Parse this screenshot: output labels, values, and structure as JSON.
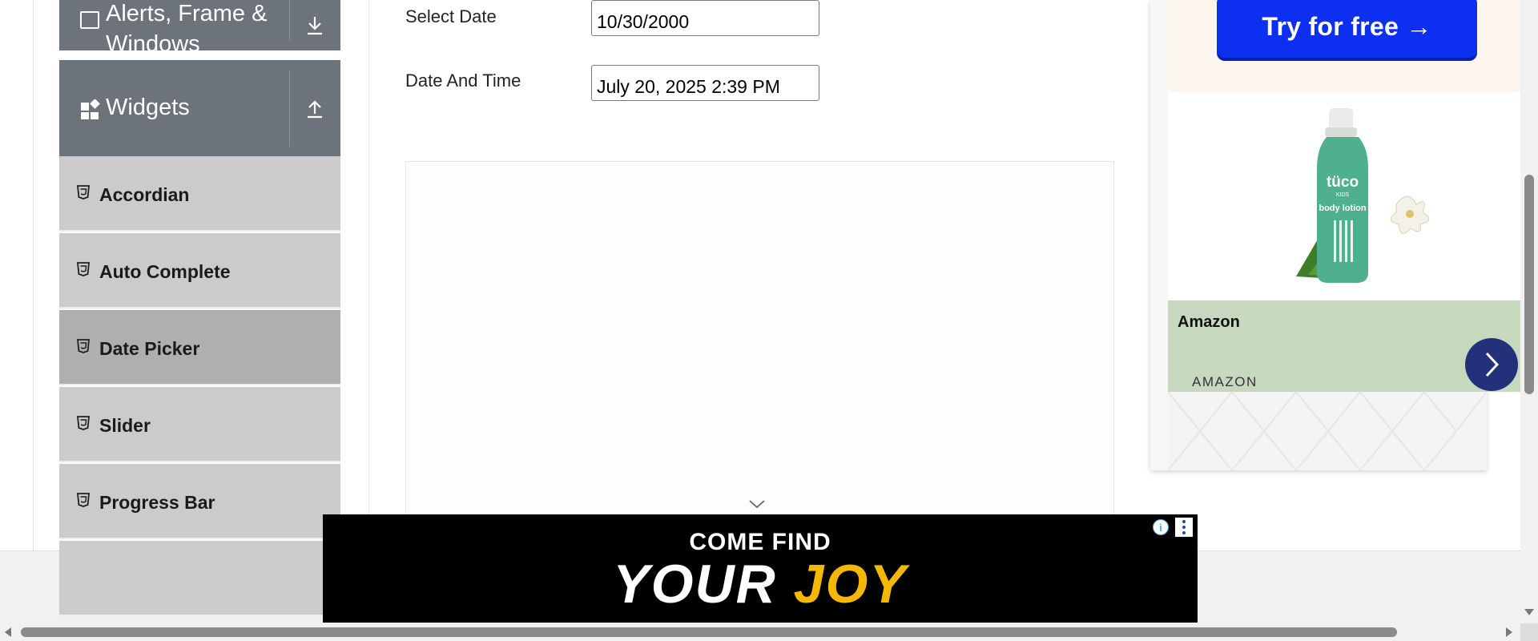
{
  "sidebar": {
    "groups": [
      {
        "label": "Alerts, Frame & Windows",
        "icon": "window-icon",
        "toggle_icon": "download-icon"
      },
      {
        "label": "Widgets",
        "icon": "widgets-icon",
        "toggle_icon": "upload-icon"
      }
    ],
    "items": [
      {
        "label": "Accordian",
        "icon": "html5-icon",
        "active": false
      },
      {
        "label": "Auto Complete",
        "icon": "html5-icon",
        "active": false
      },
      {
        "label": "Date Picker",
        "icon": "html5-icon",
        "active": true
      },
      {
        "label": "Slider",
        "icon": "html5-icon",
        "active": false
      },
      {
        "label": "Progress Bar",
        "icon": "html5-icon",
        "active": false
      }
    ]
  },
  "form": {
    "select_date_label": "Select Date",
    "select_date_value": "10/30/2000",
    "date_time_label": "Date And Time",
    "date_time_value": "July 20, 2025 2:39 PM"
  },
  "ads": {
    "try_button": "Try for free →",
    "product_brand": "Amazon",
    "product_domain": "AMAZON",
    "product_bottle_brand": "tüco",
    "product_bottle_sub": "KIDS",
    "product_bottle_name": "body lotion",
    "banner_line1": "COME FIND",
    "banner_your": "YOUR",
    "banner_joy": "JOY",
    "info_glyph": "i"
  },
  "colors": {
    "sidebar_header": "#6c737a",
    "sidebar_item": "#cbcbcb",
    "sidebar_item_active": "#afafaf",
    "cta_blue": "#0d2ff0",
    "product_info_bg": "#c6d9bf",
    "go_button": "#22317a",
    "banner_joy": "#f5b800"
  }
}
